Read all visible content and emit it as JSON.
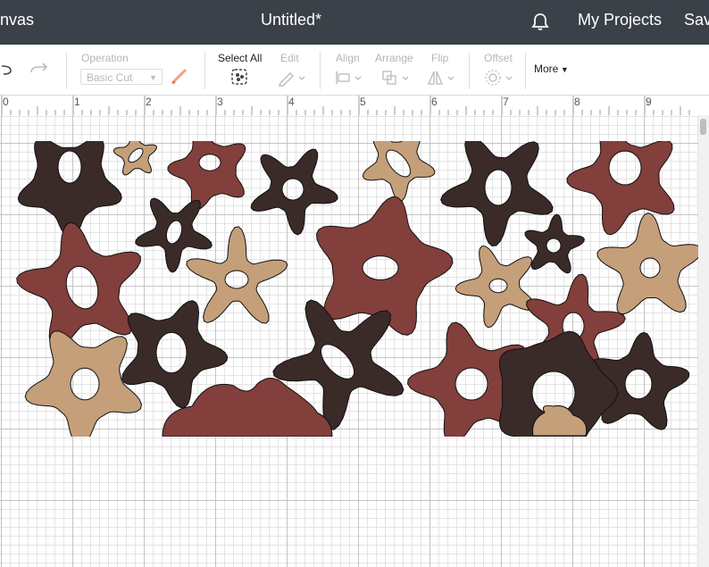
{
  "header": {
    "canvas_label": "nvas",
    "title": "Untitled*",
    "my_projects": "My Projects",
    "save": "Sav"
  },
  "toolbar": {
    "operation_label": "Operation",
    "operation_value": "Basic Cut",
    "select_all": "Select All",
    "edit": "Edit",
    "align": "Align",
    "arrange": "Arrange",
    "flip": "Flip",
    "offset": "Offset",
    "more": "More"
  },
  "ruler": {
    "numbers": [
      "0",
      "1",
      "2",
      "3",
      "4",
      "5",
      "6",
      "7",
      "8",
      "9"
    ]
  },
  "colors": {
    "dark_brown": "#3a2a28",
    "rust": "#823f3b",
    "tan": "#c49f7a",
    "topbar": "#3b4148"
  },
  "design": {
    "shapes": [
      {
        "color": "dark_brown"
      },
      {
        "color": "tan"
      },
      {
        "color": "rust"
      },
      {
        "color": "dark_brown"
      },
      {
        "color": "tan"
      },
      {
        "color": "dark_brown"
      },
      {
        "color": "rust"
      },
      {
        "color": "dark_brown"
      },
      {
        "color": "tan"
      },
      {
        "color": "rust"
      },
      {
        "color": "dark_brown"
      },
      {
        "color": "rust"
      },
      {
        "color": "tan"
      },
      {
        "color": "tan"
      },
      {
        "color": "rust"
      },
      {
        "color": "dark_brown"
      },
      {
        "color": "dark_brown"
      },
      {
        "color": "tan"
      },
      {
        "color": "rust"
      },
      {
        "color": "dark_brown"
      },
      {
        "color": "rust"
      },
      {
        "color": "dark_brown"
      },
      {
        "color": "tan"
      }
    ]
  }
}
